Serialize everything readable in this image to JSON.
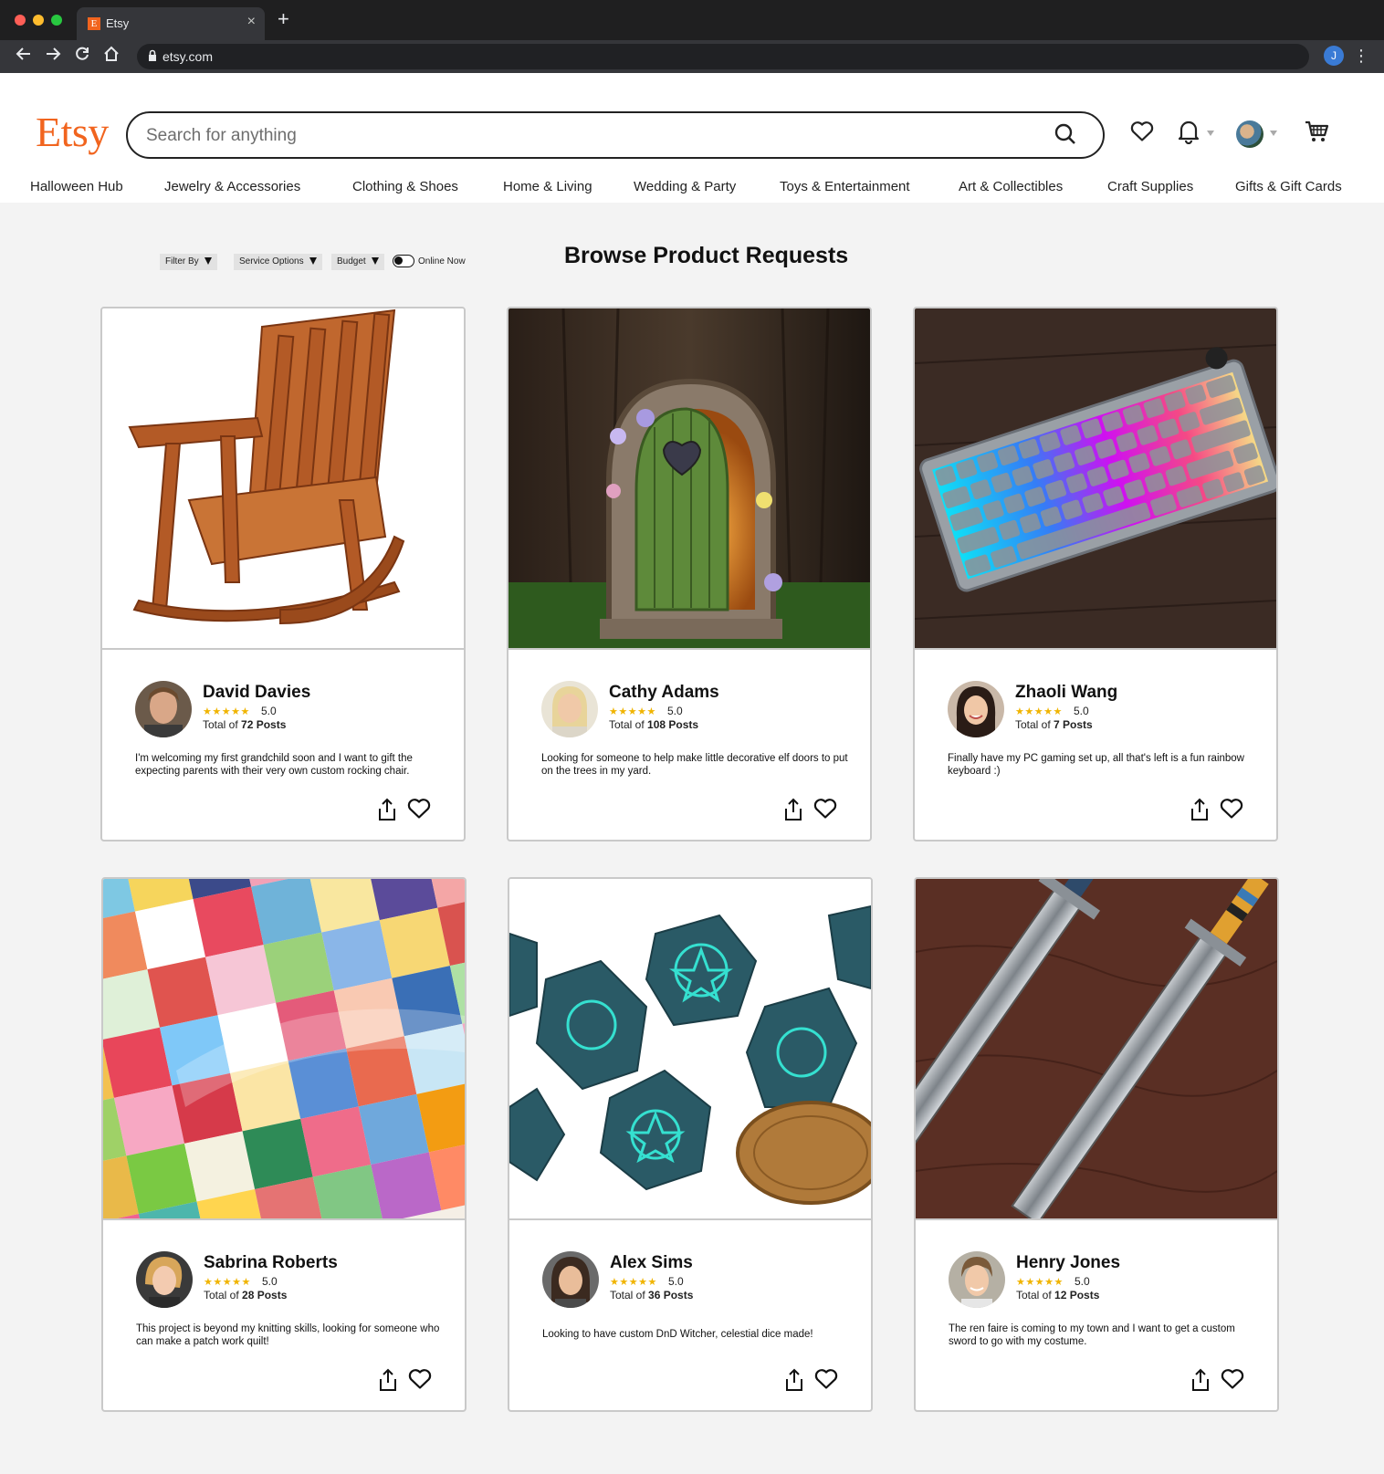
{
  "browser": {
    "tab_title": "Etsy",
    "tab_favicon": "E",
    "url": "etsy.com",
    "profile_initial": "J"
  },
  "header": {
    "logo": "Etsy",
    "search_placeholder": "Search for anything",
    "icons": [
      "heart-icon",
      "bell-icon",
      "avatar",
      "cart-icon"
    ]
  },
  "categories": [
    "Halloween Hub",
    "Jewelry & Accessories",
    "Clothing & Shoes",
    "Home & Living",
    "Wedding & Party",
    "Toys & Entertainment",
    "Art & Collectibles",
    "Craft Supplies",
    "Gifts & Gift Cards"
  ],
  "filters": {
    "filter_by": "Filter By",
    "service_options": "Service Options",
    "budget": "Budget",
    "online_now": "Online Now"
  },
  "page_title": "Browse Product Requests",
  "cards": [
    {
      "name": "David Davies",
      "stars": "★★★★★",
      "rating": "5.0",
      "posts_prefix": "Total of ",
      "posts": "72 Posts",
      "description": "I'm welcoming my first grandchild soon and I want to gift the expecting parents with their very own custom rocking chair.",
      "image": "rocking-chair"
    },
    {
      "name": "Cathy Adams",
      "stars": "★★★★★",
      "rating": "5.0",
      "posts_prefix": "Total of ",
      "posts": "108 Posts",
      "description": "Looking for someone to help make little decorative elf doors to put on the trees in my yard.",
      "image": "elf-door"
    },
    {
      "name": "Zhaoli Wang",
      "stars": "★★★★★",
      "rating": "5.0",
      "posts_prefix": "Total of ",
      "posts": "7 Posts",
      "description": "Finally have my PC gaming set up, all that's left is a fun rainbow keyboard :)",
      "image": "rainbow-keyboard"
    },
    {
      "name": "Sabrina Roberts",
      "stars": "★★★★★",
      "rating": "5.0",
      "posts_prefix": "Total of ",
      "posts": "28 Posts",
      "description": "This project is beyond my knitting skills, looking for someone who can make a patch work quilt!",
      "image": "patchwork-quilt"
    },
    {
      "name": "Alex Sims",
      "stars": "★★★★★",
      "rating": "5.0",
      "posts_prefix": "Total of ",
      "posts": "36 Posts",
      "description": "Looking to have custom DnD Witcher, celestial dice made!",
      "image": "dnd-dice"
    },
    {
      "name": "Henry Jones",
      "stars": "★★★★★",
      "rating": "5.0",
      "posts_prefix": "Total of ",
      "posts": "12 Posts",
      "description": "The ren faire is coming to my town and I want to get a custom sword to go with my costume.",
      "image": "damascus-swords"
    }
  ],
  "colors": {
    "brand": "#f1641e",
    "star": "#f0b400",
    "page_bg": "#f3f3f3"
  }
}
